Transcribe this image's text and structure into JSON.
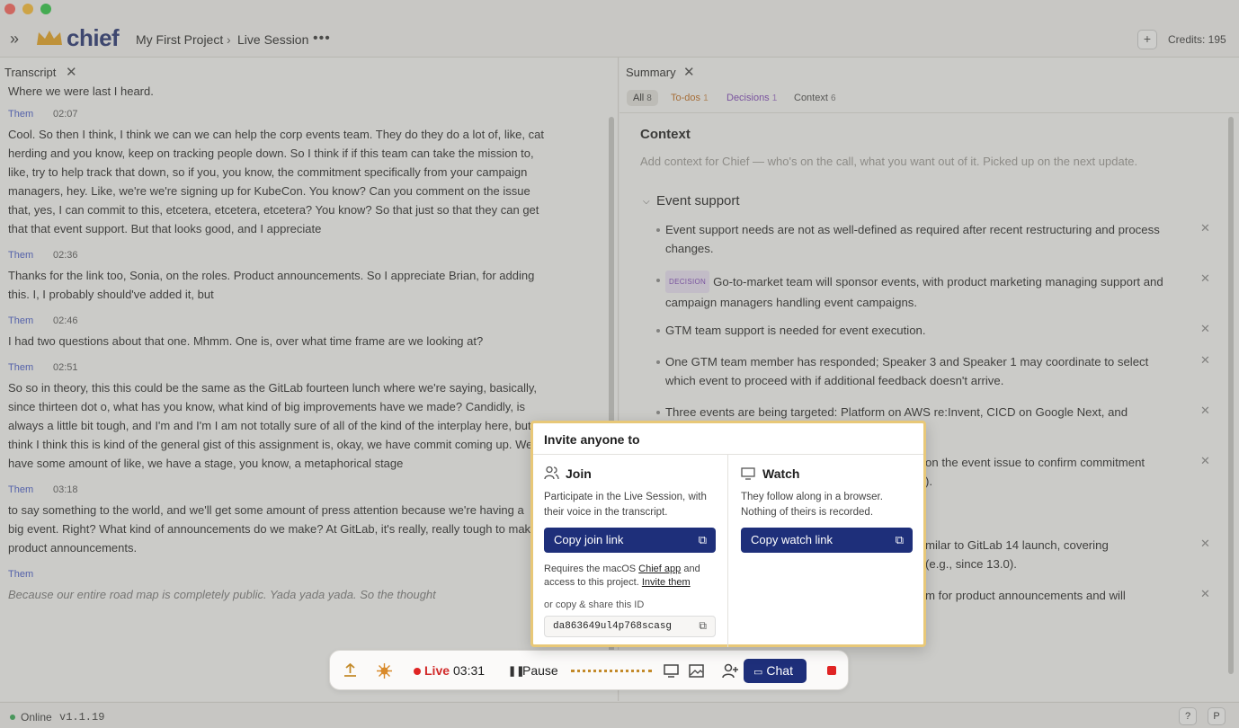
{
  "header": {
    "app_name": "chief",
    "breadcrumb_project": "My First Project",
    "breadcrumb_sep": "›",
    "breadcrumb_session": "Live Session",
    "more": "•••",
    "plus": "+",
    "credits": "Credits: 195",
    "expand_icon": "»"
  },
  "transcript": {
    "title": "Transcript",
    "close": "✕",
    "cut_line": "Where we were last I heard.",
    "entries": [
      {
        "speaker": "Them",
        "time": "02:07",
        "text": "Cool. So then I think, I think we can we can help the corp events team. They do they do a lot of, like, cat herding and you know, keep on tracking people down. So I think if if this team can take the mission to, like, try to help track that down, so if you, you know, the commitment specifically from your campaign managers, hey. Like, we're we're signing up for KubeCon. You know? Can you comment on the issue that, yes, I can commit to this, etcetera, etcetera, etcetera? You know? So that just so that they can get that that event support. But that looks good, and I appreciate"
      },
      {
        "speaker": "Them",
        "time": "02:36",
        "text": "Thanks for the link too, Sonia, on the roles. Product announcements. So I appreciate Brian, for adding this. I, I probably should've added it, but"
      },
      {
        "speaker": "Them",
        "time": "02:46",
        "text": "I had two questions about that one. Mhmm. One is, over what time frame are we looking at?"
      },
      {
        "speaker": "Them",
        "time": "02:51",
        "text": "So so in theory, this this could be the same as the GitLab fourteen lunch where we're saying, basically, since thirteen dot o, what has you know, what kind of big improvements have we made? Candidly, is always a little bit tough, and I'm and I'm I am not totally sure of all of the kind of the interplay here, but I think I think this is kind of the general gist of this assignment is, okay, we have commit coming up. We have some amount of like, we have a stage, you know, a metaphorical stage"
      },
      {
        "speaker": "Them",
        "time": "03:18",
        "text": "to say something to the world, and we'll get some amount of press attention because we're having a big event. Right? What kind of announcements do we make? At GitLab, it's really, really tough to make product announcements."
      },
      {
        "speaker": "Them",
        "time": "",
        "text": "Because our entire road map is completely public. Yada yada yada. So the thought"
      }
    ]
  },
  "summary": {
    "title": "Summary",
    "close": "✕",
    "filters": [
      {
        "label": "All",
        "count": "8",
        "color": "#222222"
      },
      {
        "label": "To-dos",
        "count": "1",
        "color": "#c06a1a"
      },
      {
        "label": "Decisions",
        "count": "1",
        "color": "#7b3fb8"
      },
      {
        "label": "Context",
        "count": "6",
        "color": "#444444"
      }
    ],
    "context_title": "Context",
    "context_placeholder": "Add context for Chief — who's on the call, what you want out of it. Picked up on the next update.",
    "section_title": "Event support",
    "decision_badge": "DECISION",
    "items": [
      "Event support needs are not as well-defined as required after recent restructuring and process changes.",
      "Go-to-market team will sponsor events, with product marketing managing support and campaign managers handling event campaigns.",
      "GTM team support is needed for event execution.",
      "One GTM team member has responded; Speaker 3 and Speaker 1 may coordinate to select which event to proceed with if additional feedback doesn't arrive.",
      "Three events are being targeted: Platform on AWS re:Invent, CICD on Google Next, and",
      "on the event issue to confirm commitment",
      ").",
      "milar to GitLab 14 launch, covering",
      "(e.g., since 13.0).",
      "m for product announcements and will"
    ],
    "remove": "✕"
  },
  "toolbar": {
    "live": "Live",
    "time": "03:31",
    "pause_icon": "❚❚",
    "pause": "Pause",
    "chat": "Chat",
    "chat_icon": "💬"
  },
  "invite": {
    "title": "Invite anyone to",
    "join_title": "Join",
    "join_desc": "Participate in the Live Session, with their voice in the transcript.",
    "join_button": "Copy join link",
    "watch_title": "Watch",
    "watch_desc": "They follow along in a browser. Nothing of theirs is recorded.",
    "watch_button": "Copy watch link",
    "req_prefix": "Requires the macOS",
    "req_link_app": "Chief app",
    "req_mid": "and access to this project.",
    "req_link_invite": "Invite them",
    "or_copy": "or copy & share this ID",
    "session_id": "da863649ul4p768scasg"
  },
  "status": {
    "online": "Online",
    "version": "v1.1.19",
    "help": "?",
    "profile": "P"
  }
}
